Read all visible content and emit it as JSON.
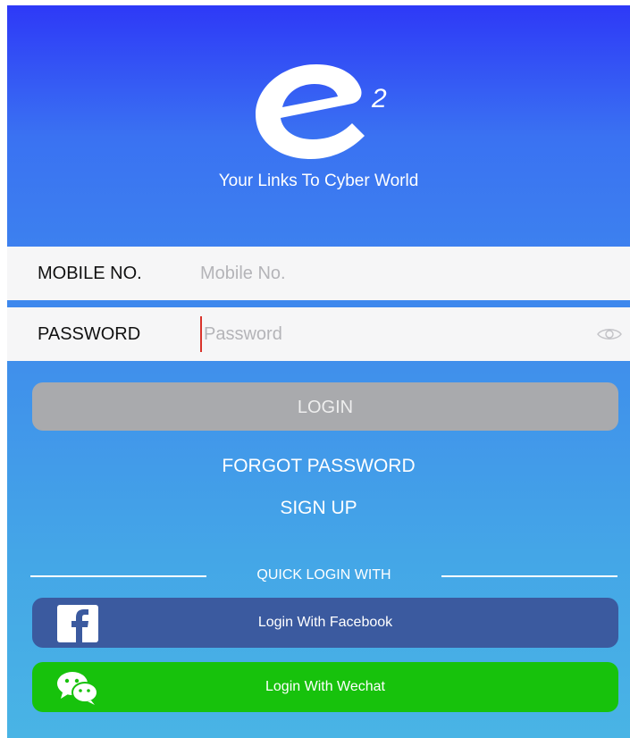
{
  "header": {
    "logo_superscript": "2",
    "tagline": "Your Links To Cyber World"
  },
  "form": {
    "mobile": {
      "label": "MOBILE NO.",
      "placeholder": "Mobile No.",
      "value": ""
    },
    "password": {
      "label": "PASSWORD",
      "placeholder": "Password",
      "value": ""
    }
  },
  "actions": {
    "login_label": "LOGIN",
    "forgot_label": "FORGOT PASSWORD",
    "signup_label": "SIGN UP"
  },
  "quick_login": {
    "label": "QUICK LOGIN WITH",
    "facebook_label": "Login With Facebook",
    "wechat_label": "Login With Wechat"
  },
  "colors": {
    "gradient_top": "#2e39f7",
    "gradient_bottom": "#49b4e5",
    "login_button": "#a9aaad",
    "facebook": "#3b5a9f",
    "wechat": "#17c20c",
    "cursor": "#d9332b"
  },
  "icons": [
    "app-logo",
    "eye-icon",
    "facebook-icon",
    "wechat-icon"
  ]
}
